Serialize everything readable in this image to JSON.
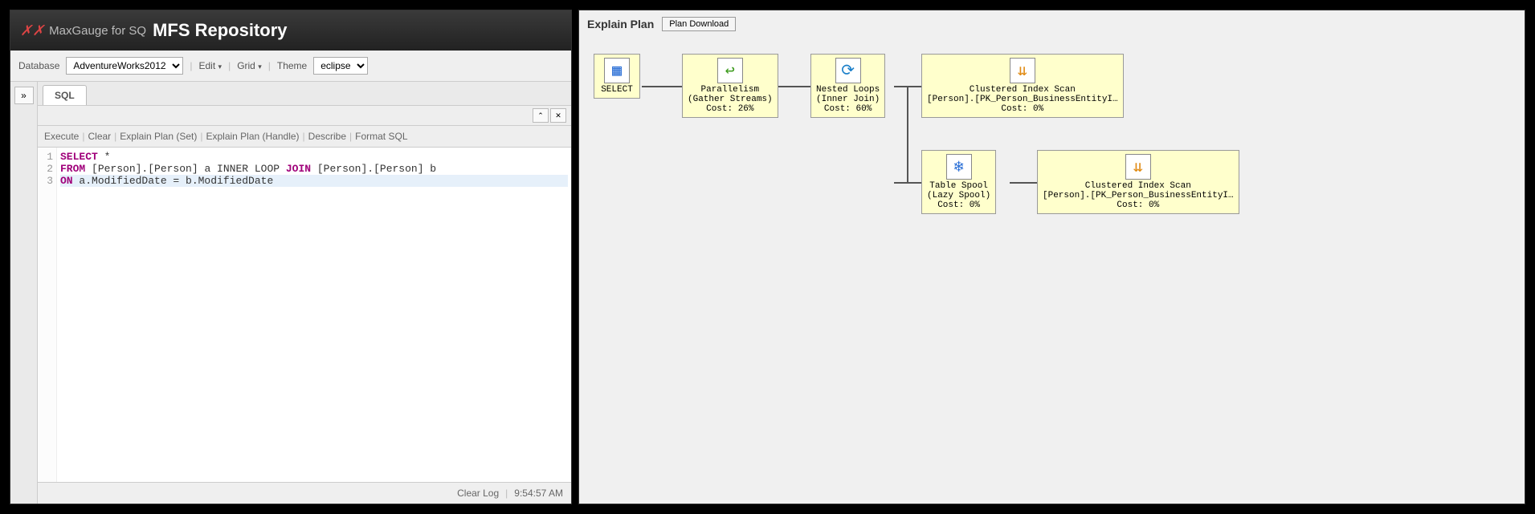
{
  "header": {
    "app_name_prefix": "MaxGauge for SQ",
    "repo_title": "MFS Repository"
  },
  "toolbar": {
    "database_label": "Database",
    "database_value": "AdventureWorks2012",
    "edit_label": "Edit",
    "grid_label": "Grid",
    "theme_label": "Theme",
    "theme_value": "eclipse"
  },
  "tabs": {
    "sql": "SQL"
  },
  "panel_controls": {
    "up": "⌃",
    "close": "✕"
  },
  "actions": {
    "execute": "Execute",
    "clear": "Clear",
    "explain_set": "Explain Plan (Set)",
    "explain_handle": "Explain Plan (Handle)",
    "describe": "Describe",
    "format": "Format SQL"
  },
  "sql": {
    "gutter": [
      "1",
      "2",
      "3"
    ],
    "line1_kw": "SELECT",
    "line1_rest": " *",
    "line2_kw1": "FROM",
    "line2_mid": " [Person].[Person] a INNER LOOP ",
    "line2_kw2": "JOIN",
    "line2_rest": " [Person].[Person] b",
    "line3_kw": "ON",
    "line3_rest": " a.ModifiedDate = b.ModifiedDate"
  },
  "status": {
    "clear_log": "Clear Log",
    "time": "9:54:57 AM"
  },
  "explain": {
    "title": "Explain Plan",
    "download": "Plan Download",
    "nodes": {
      "select": {
        "label": "SELECT"
      },
      "parallel": {
        "l1": "Parallelism",
        "l2": "(Gather Streams)",
        "l3": "Cost: 26%"
      },
      "nested": {
        "l1": "Nested Loops",
        "l2": "(Inner Join)",
        "l3": "Cost: 60%"
      },
      "cix1": {
        "l1": "Clustered Index Scan",
        "l2": "[Person].[PK_Person_BusinessEntityI…",
        "l3": "Cost: 0%"
      },
      "spool": {
        "l1": "Table Spool",
        "l2": "(Lazy Spool)",
        "l3": "Cost: 0%"
      },
      "cix2": {
        "l1": "Clustered Index Scan",
        "l2": "[Person].[PK_Person_BusinessEntityI…",
        "l3": "Cost: 0%"
      }
    }
  }
}
